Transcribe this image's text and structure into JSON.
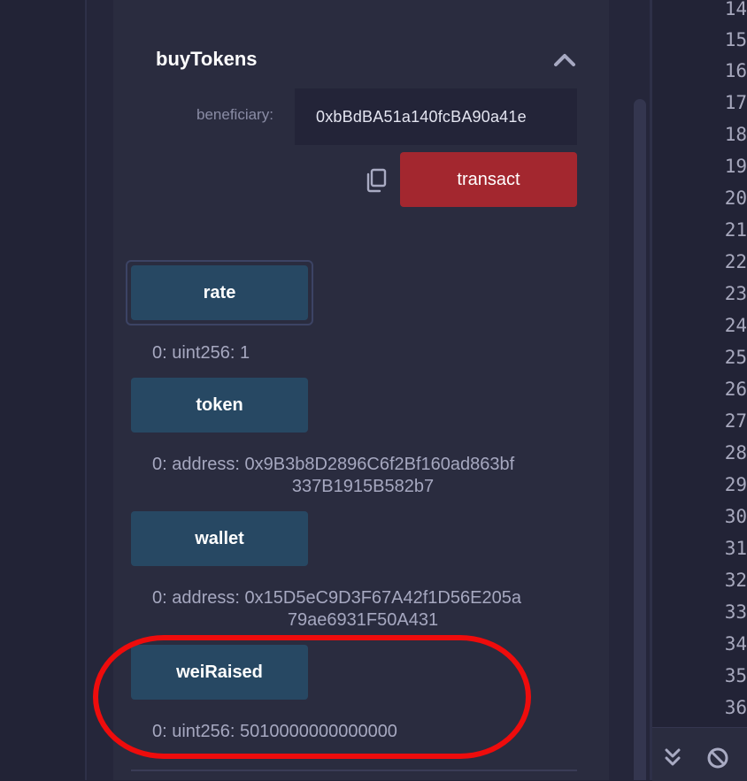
{
  "contract": {
    "function_name": "buyTokens",
    "param_label": "beneficiary:",
    "param_value": "0xbBdBA51a140fcBA90a41e",
    "transact_label": "transact"
  },
  "calls": [
    {
      "label": "rate",
      "output": "0: uint256: 1"
    },
    {
      "label": "token",
      "output_line1": "0:  address: 0x9B3b8D2896C6f2Bf160ad863bf",
      "output_line2": "337B1915B582b7"
    },
    {
      "label": "wallet",
      "output_line1": "0:  address: 0x15D5eC9D3F67A42f1D56E205a",
      "output_line2": "79ae6931F50A431"
    },
    {
      "label": "weiRaised",
      "output": "0: uint256: 5010000000000000"
    }
  ],
  "editor": {
    "line_numbers": [
      "14",
      "15",
      "16",
      "17",
      "18",
      "19",
      "20",
      "21",
      "22",
      "23",
      "24",
      "25",
      "26",
      "27",
      "28",
      "29",
      "30",
      "31",
      "32",
      "33",
      "34",
      "35",
      "36"
    ]
  },
  "colors": {
    "transact": "#a3272f",
    "call_button": "#274863",
    "highlight": "#ee0c0c"
  },
  "icons": [
    "chevron-up-icon",
    "copy-icon",
    "double-chevron-down-icon",
    "ban-icon"
  ]
}
